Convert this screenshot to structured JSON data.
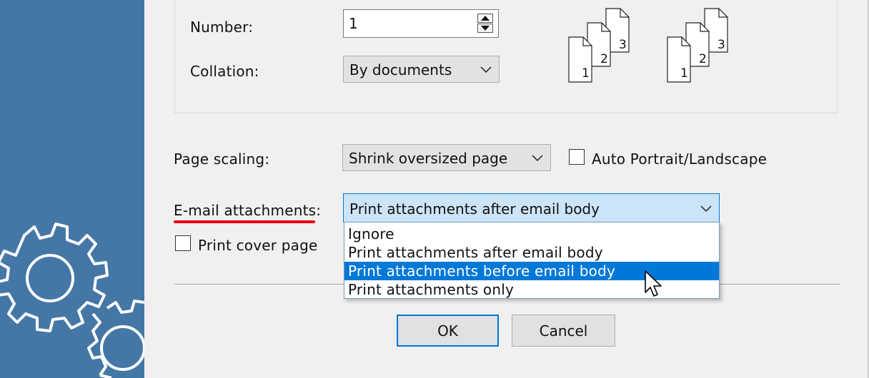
{
  "copies": {
    "number_label": "Number:",
    "number_value": "1",
    "collation_label": "Collation:",
    "collation_value": "By documents",
    "collate_icons": [
      {
        "pages": [
          "1",
          "2",
          "3"
        ]
      },
      {
        "pages": [
          "1",
          "2",
          "3"
        ]
      }
    ]
  },
  "scaling": {
    "label": "Page scaling:",
    "value": "Shrink oversized page",
    "auto_rotate_label": "Auto Portrait/Landscape",
    "auto_rotate_checked": false
  },
  "attachments": {
    "label": "E-mail attachments:",
    "value": "Print attachments after email body",
    "options": [
      "Ignore",
      "Print attachments after email body",
      "Print attachments before email body",
      "Print attachments only"
    ],
    "highlighted_option_index": 2
  },
  "cover_page": {
    "label": "Print cover page",
    "checked": false
  },
  "buttons": {
    "ok": "OK",
    "cancel": "Cancel"
  },
  "colors": {
    "sidebar": "#4477a6",
    "accent": "#0078d7",
    "annotation_underline": "#e8000c"
  }
}
